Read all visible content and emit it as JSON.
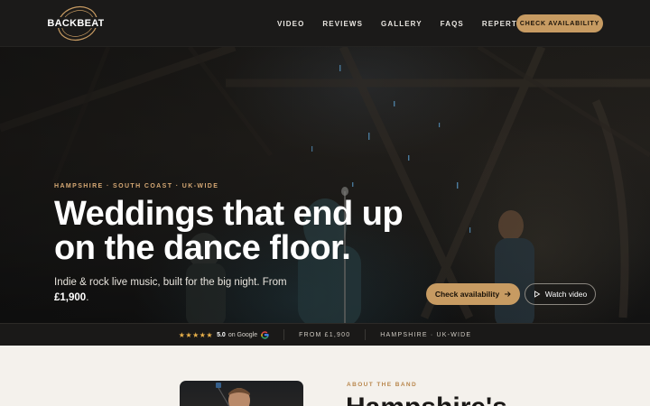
{
  "nav": {
    "logo_text": "BACKBEAT",
    "links": [
      "VIDEO",
      "REVIEWS",
      "GALLERY",
      "FAQS",
      "REPERTOIRE"
    ],
    "cta": "CHECK AVAILABILITY"
  },
  "hero": {
    "eyebrow": "HAMPSHIRE · SOUTH COAST · UK-WIDE",
    "headline": "Weddings that end up on the dance floor.",
    "sub_text": "Indie & rock live music, built for the big night. From ",
    "sub_price": "£1,900",
    "sub_end": ".",
    "primary_button": "Check availability",
    "secondary_button": "Watch video"
  },
  "trust": {
    "stars": "★★★★★",
    "rating": "5.0",
    "rating_suffix": "on Google",
    "price": "FROM £1,900",
    "region": "HAMPSHIRE · UK-WIDE"
  },
  "about": {
    "eyebrow": "ABOUT THE BAND",
    "title": "Hampshire's"
  },
  "colors": {
    "accent": "#c79b62",
    "nav_bg": "#1b1a19",
    "cream": "#f4f1ec"
  }
}
